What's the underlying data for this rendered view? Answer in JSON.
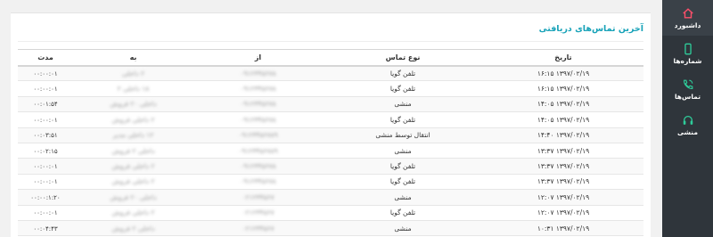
{
  "sidebar": {
    "items": [
      {
        "label": "داشبورد",
        "icon": "home-icon"
      },
      {
        "label": "شماره‌ها",
        "icon": "phone-device-icon"
      },
      {
        "label": "تماس‌ها",
        "icon": "phone-call-icon"
      },
      {
        "label": "منشی",
        "icon": "headset-icon"
      }
    ]
  },
  "colors": {
    "accent": "#17a2b8",
    "sidebar": "#2f353b"
  },
  "panel": {
    "title": "آخرین تماس‌های دریافتی",
    "columns": {
      "date": "تاریخ",
      "type": "نوع تماس",
      "from": "از",
      "to": "به",
      "duration": "مدت"
    },
    "rows": [
      {
        "date": "۱۳۹۷/۰۲/۱۹ ۱۶:۱۵",
        "type": "تلفن گویا",
        "from": "۰۹۱۲۳۴۵۶۷۸",
        "to": "۲ داخلی",
        "duration": "۰۰:۰۰:۰۱"
      },
      {
        "date": "۱۳۹۷/۰۲/۱۹ ۱۶:۱۵",
        "type": "تلفن گویا",
        "from": "۰۹۱۲۳۴۵۶۷۸",
        "to": "۱۸ داخلی ۲",
        "duration": "۰۰:۰۰:۰۱"
      },
      {
        "date": "۱۳۹۷/۰۲/۱۹ ۱۴:۰۵",
        "type": "منشی",
        "from": "۰۹۱۲۳۴۵۶۷۸",
        "to": "داخلی ۲۰ فروش",
        "duration": "۰۰:۰۱:۵۴"
      },
      {
        "date": "۱۳۹۷/۰۲/۱۹ ۱۴:۰۵",
        "type": "تلفن گویا",
        "from": "۰۹۱۲۳۴۵۶۷۸",
        "to": "۲ داخلی فروش",
        "duration": "۰۰:۰۰:۰۱"
      },
      {
        "date": "۱۳۹۷/۰۲/۱۹ ۱۴:۴۰",
        "type": "انتقال توسط منشی",
        "from": "۰۹۱۲۳۴۵۶۷۸۹",
        "to": "۱۲ داخلی مدیر",
        "duration": "۰۰:۰۳:۵۱"
      },
      {
        "date": "۱۳۹۷/۰۲/۱۹ ۱۳:۳۷",
        "type": "منشی",
        "from": "۰۹۱۲۳۴۵۶۷۸۹",
        "to": "داخلی ۲ فروش",
        "duration": "۰۰:۰۲:۱۵"
      },
      {
        "date": "۱۳۹۷/۰۲/۱۹ ۱۳:۳۷",
        "type": "تلفن گویا",
        "from": "۰۹۱۲۳۴۵۶۷۸",
        "to": "۲ داخلی فروش",
        "duration": "۰۰:۰۰:۰۱"
      },
      {
        "date": "۱۳۹۷/۰۲/۱۹ ۱۳:۳۷",
        "type": "تلفن گویا",
        "from": "۰۹۱۲۳۴۵۶۷۸",
        "to": "۲ داخلی فروش",
        "duration": "۰۰:۰۰:۰۱"
      },
      {
        "date": "۱۳۹۷/۰۲/۱۹ ۱۲:۰۷",
        "type": "منشی",
        "from": "۰۲۱۲۳۴۵۶۷",
        "to": "داخلی ۲۰ فروش",
        "duration": "۰۰:۰۰:۱:۲۰"
      },
      {
        "date": "۱۳۹۷/۰۲/۱۹ ۱۲:۰۷",
        "type": "تلفن گویا",
        "from": "۰۲۱۲۳۴۵۶۷",
        "to": "۲ داخلی فروش",
        "duration": "۰۰:۰۰:۰۱"
      },
      {
        "date": "۱۳۹۷/۰۲/۱۹ ۱۰:۳۱",
        "type": "منشی",
        "from": "۰۲۱۲۳۴۵۶۷",
        "to": "داخلی ۲ فروش",
        "duration": "۰۰:۰۴:۴۳"
      }
    ]
  }
}
